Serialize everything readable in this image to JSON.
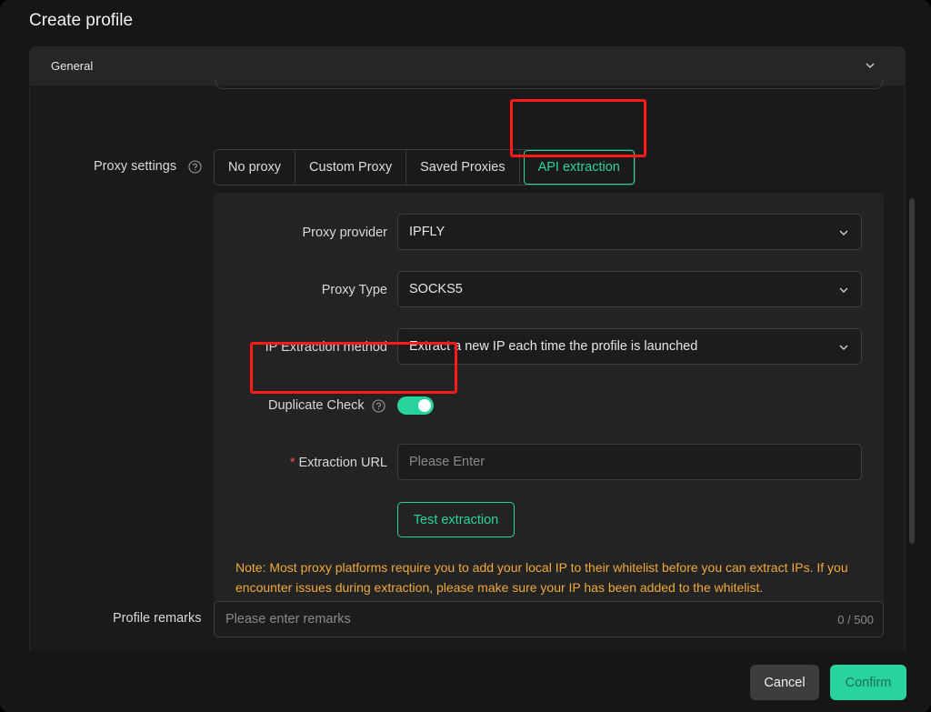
{
  "dialog": {
    "title": "Create profile"
  },
  "section": {
    "title": "General"
  },
  "proxy_settings": {
    "label": "Proxy settings",
    "tabs": [
      {
        "label": "No proxy"
      },
      {
        "label": "Custom Proxy"
      },
      {
        "label": "Saved Proxies"
      },
      {
        "label": "API extraction",
        "active": true
      }
    ]
  },
  "api_extraction": {
    "provider": {
      "label": "Proxy provider",
      "value": "IPFLY"
    },
    "type": {
      "label": "Proxy Type",
      "value": "SOCKS5"
    },
    "method": {
      "label": "IP Extraction method",
      "value": "Extract a new IP each time the profile is launched"
    },
    "duplicate_check": {
      "label": "Duplicate Check",
      "enabled": true
    },
    "url": {
      "required_mark": "*",
      "label": "Extraction URL",
      "placeholder": "Please Enter",
      "value": ""
    },
    "test_button": "Test extraction",
    "note": "Note: Most proxy platforms require you to add your local IP to their whitelist before you can extract IPs. If you encounter issues during extraction, please make sure your IP has been added to the whitelist."
  },
  "remarks": {
    "label": "Profile remarks",
    "placeholder": "Please enter remarks",
    "counter": "0 / 500"
  },
  "footer": {
    "cancel": "Cancel",
    "confirm": "Confirm"
  },
  "colors": {
    "accent": "#29d3a0",
    "highlight": "#ff1a1a",
    "note": "#f0a93a",
    "background": "#161616"
  }
}
